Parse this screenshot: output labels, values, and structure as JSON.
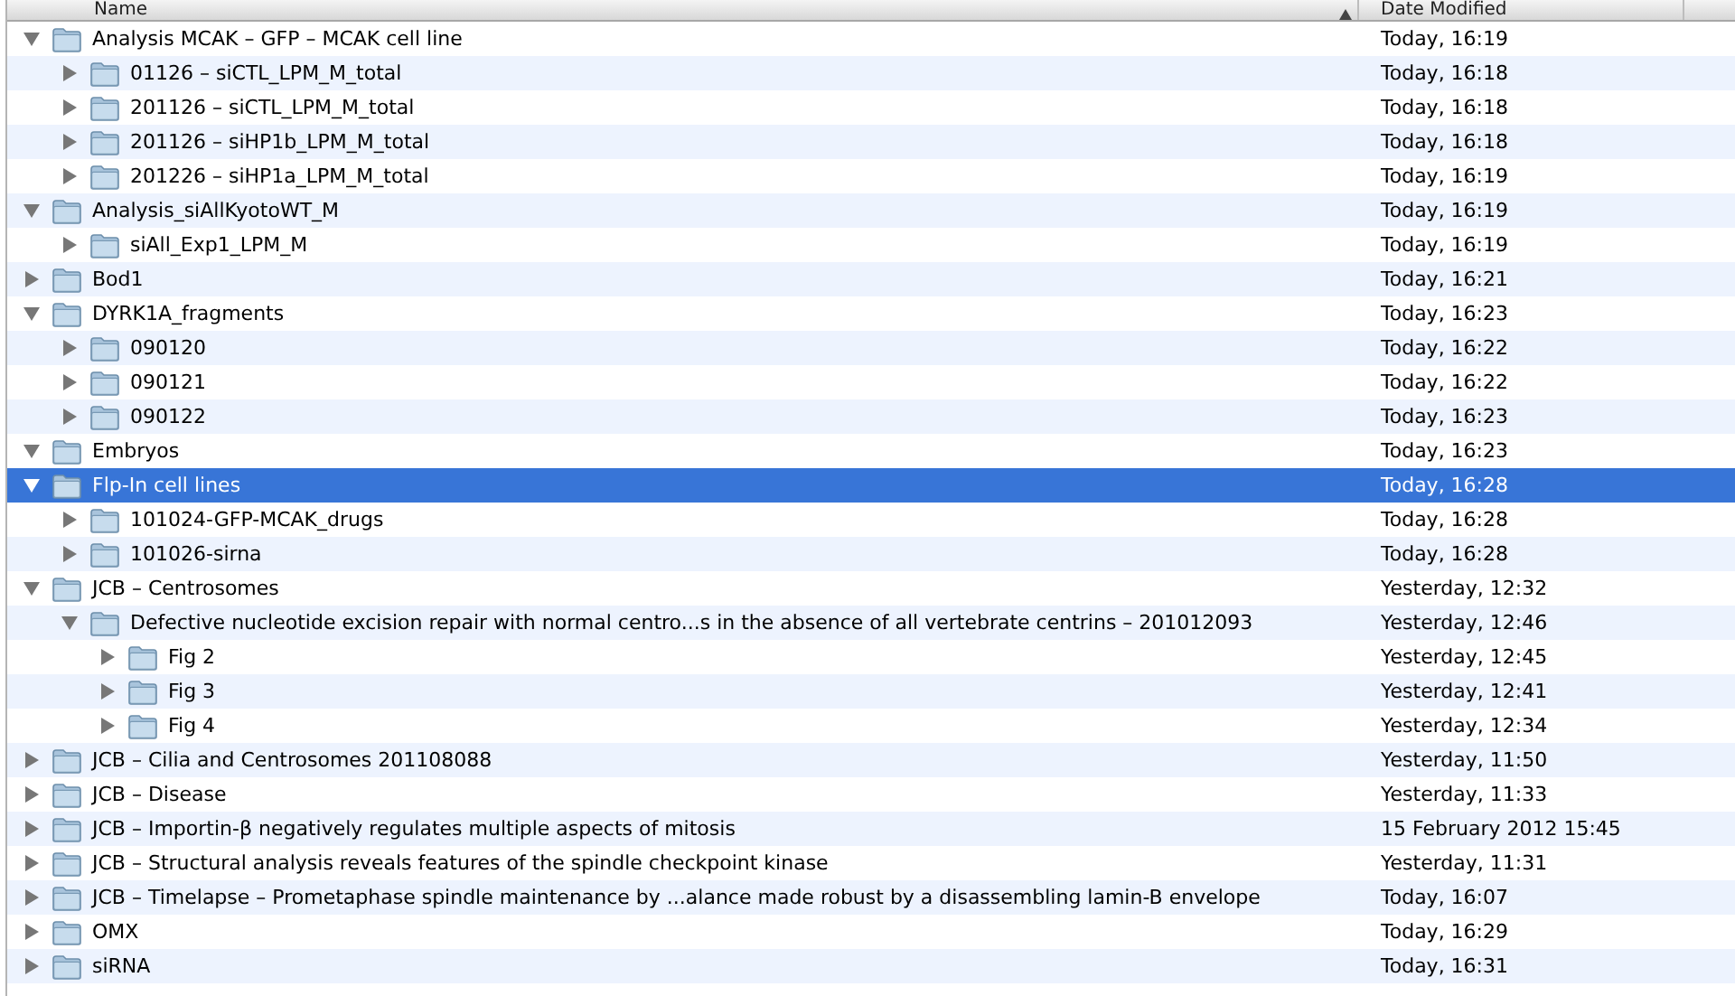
{
  "columns": [
    {
      "label": "Name",
      "sorted": true
    },
    {
      "label": "Date Modified",
      "sorted": false
    }
  ],
  "items": [
    {
      "name": "Analysis MCAK – GFP – MCAK cell line",
      "date": "Today, 16:19",
      "expanded": true,
      "selected": false,
      "children": [
        {
          "name": "01126 – siCTL_LPM_M_total",
          "date": "Today, 16:18",
          "expanded": false,
          "selected": false
        },
        {
          "name": "201126 – siCTL_LPM_M_total",
          "date": "Today, 16:18",
          "expanded": false,
          "selected": false
        },
        {
          "name": "201126 – siHP1b_LPM_M_total",
          "date": "Today, 16:18",
          "expanded": false,
          "selected": false
        },
        {
          "name": "201226 – siHP1a_LPM_M_total",
          "date": "Today, 16:19",
          "expanded": false,
          "selected": false
        }
      ]
    },
    {
      "name": "Analysis_siAllKyotoWT_M",
      "date": "Today, 16:19",
      "expanded": true,
      "selected": false,
      "children": [
        {
          "name": "siAll_Exp1_LPM_M",
          "date": "Today, 16:19",
          "expanded": false,
          "selected": false
        }
      ]
    },
    {
      "name": "Bod1",
      "date": "Today, 16:21",
      "expanded": false,
      "selected": false
    },
    {
      "name": "DYRK1A_fragments",
      "date": "Today, 16:23",
      "expanded": true,
      "selected": false,
      "children": [
        {
          "name": "090120",
          "date": "Today, 16:22",
          "expanded": false,
          "selected": false
        },
        {
          "name": "090121",
          "date": "Today, 16:22",
          "expanded": false,
          "selected": false
        },
        {
          "name": "090122",
          "date": "Today, 16:23",
          "expanded": false,
          "selected": false
        }
      ]
    },
    {
      "name": "Embryos",
      "date": "Today, 16:23",
      "expanded": true,
      "selected": false
    },
    {
      "name": "Flp-In cell lines",
      "date": "Today, 16:28",
      "expanded": true,
      "selected": true,
      "children": [
        {
          "name": "101024-GFP-MCAK_drugs",
          "date": "Today, 16:28",
          "expanded": false,
          "selected": false
        },
        {
          "name": "101026-sirna",
          "date": "Today, 16:28",
          "expanded": false,
          "selected": false
        }
      ]
    },
    {
      "name": "JCB – Centrosomes",
      "date": "Yesterday, 12:32",
      "expanded": true,
      "selected": false,
      "children": [
        {
          "name": "Defective nucleotide excision repair with normal centro...s in the absence of all vertebrate centrins – 201012093",
          "date": "Yesterday, 12:46",
          "expanded": true,
          "selected": false,
          "children": [
            {
              "name": "Fig 2",
              "date": "Yesterday, 12:45",
              "expanded": false,
              "selected": false
            },
            {
              "name": "Fig 3",
              "date": "Yesterday, 12:41",
              "expanded": false,
              "selected": false
            },
            {
              "name": "Fig 4",
              "date": "Yesterday, 12:34",
              "expanded": false,
              "selected": false
            }
          ]
        }
      ]
    },
    {
      "name": "JCB – Cilia and Centrosomes 201108088",
      "date": "Yesterday, 11:50",
      "expanded": false,
      "selected": false
    },
    {
      "name": "JCB – Disease",
      "date": "Yesterday, 11:33",
      "expanded": false,
      "selected": false
    },
    {
      "name": "JCB – Importin-β negatively regulates multiple aspects of mitosis",
      "date": "15 February 2012 15:45",
      "expanded": false,
      "selected": false
    },
    {
      "name": "JCB – Structural analysis reveals features of the spindle checkpoint kinase",
      "date": "Yesterday, 11:31",
      "expanded": false,
      "selected": false
    },
    {
      "name": "JCB – Timelapse – Prometaphase spindle maintenance by ...alance made robust by a disassembling lamin-B envelope",
      "date": "Today, 16:07",
      "expanded": false,
      "selected": false
    },
    {
      "name": "OMX",
      "date": "Today, 16:29",
      "expanded": false,
      "selected": false
    },
    {
      "name": "siRNA",
      "date": "Today, 16:31",
      "expanded": false,
      "selected": false
    }
  ]
}
